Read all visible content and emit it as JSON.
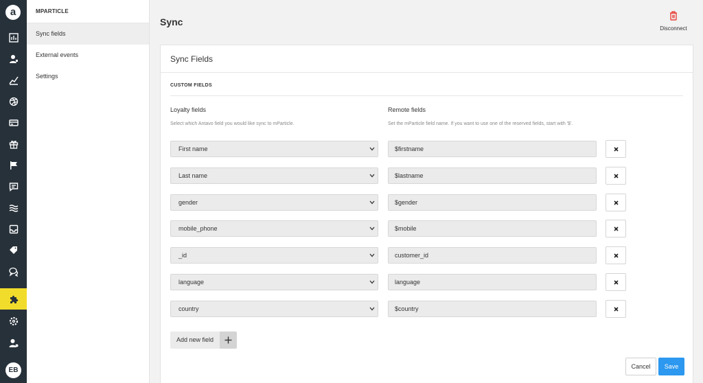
{
  "rail": {
    "logo": "a",
    "icons": [
      "dashboard-icon",
      "customers-icon",
      "analytics-icon",
      "dribbble-icon",
      "card-icon",
      "gift-icon",
      "flag-icon",
      "chat-icon",
      "waves-icon",
      "inbox-icon",
      "tags-icon",
      "comments-icon",
      "puzzle-icon",
      "gear-icon",
      "user-settings-icon"
    ],
    "active_icon": "puzzle-icon",
    "active_color": "#f2dc2b",
    "background": "#27313a",
    "avatar_initials": "EB"
  },
  "subnav": {
    "title": "MPARTICLE",
    "items": [
      {
        "label": "Sync fields",
        "active": true
      },
      {
        "label": "External events",
        "active": false
      },
      {
        "label": "Settings",
        "active": false
      }
    ]
  },
  "header": {
    "title": "Sync",
    "disconnect_label": "Disconnect",
    "disconnect_color": "#e8413a"
  },
  "card": {
    "title": "Sync Fields",
    "section_title": "CUSTOM FIELDS",
    "loyalty_heading": "Loyalty fields",
    "loyalty_help": "Select which Antavo field you would like sync to mParticle.",
    "remote_heading": "Remote fields",
    "remote_help": "Set the mParticle field name. If you want to use one of the reserved fields, start with '$'.",
    "rows": [
      {
        "loyalty": "First name",
        "remote": "$firstname"
      },
      {
        "loyalty": "Last name",
        "remote": "$lastname"
      },
      {
        "loyalty": "gender",
        "remote": "$gender"
      },
      {
        "loyalty": "mobile_phone",
        "remote": "$mobile"
      },
      {
        "loyalty": "_id",
        "remote": "customer_id"
      },
      {
        "loyalty": "language",
        "remote": "language"
      },
      {
        "loyalty": "country",
        "remote": "$country"
      }
    ],
    "add_field_label": "Add new field",
    "cancel_label": "Cancel",
    "save_label": "Save",
    "save_color": "#2c98ef"
  }
}
